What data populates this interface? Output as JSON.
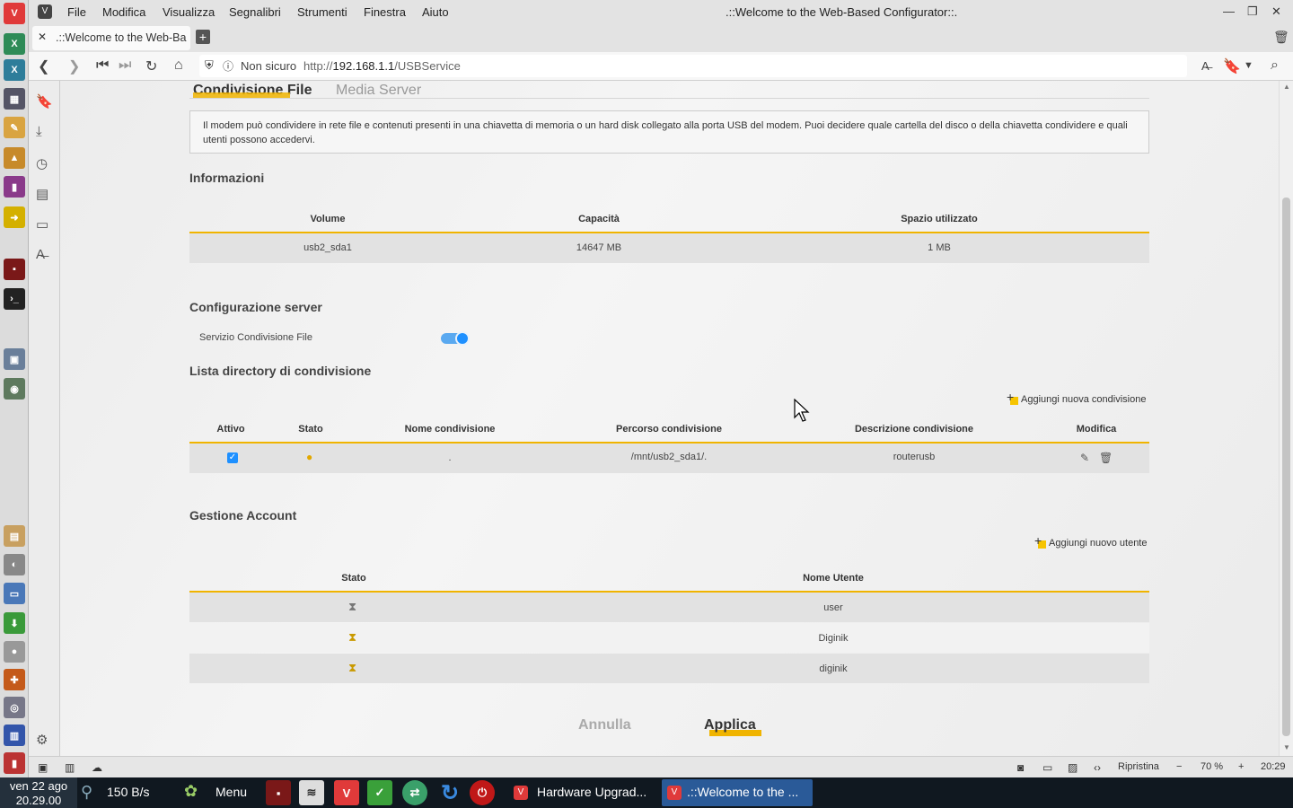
{
  "browser": {
    "menu": [
      "File",
      "Modifica",
      "Visualizza",
      "Segnalibri",
      "Strumenti",
      "Finestra",
      "Aiuto"
    ],
    "window_title": ".::Welcome to the Web-Based Configurator::.",
    "tab_title": ".::Welcome to the Web-Ba",
    "security_label": "Non sicuro",
    "url_prefix": "http://",
    "url_host": "192.168.1.1",
    "url_path": "/USBService"
  },
  "page": {
    "tabs": [
      "Condivisione File",
      "Media Server"
    ],
    "description": "Il modem può condividere in rete file e contenuti presenti in una chiavetta di memoria o un hard disk collegato alla porta USB del modem. Puoi decidere quale cartella del disco o della chiavetta condividere e quali utenti possono accedervi.",
    "info": {
      "title": "Informazioni",
      "headers": [
        "Volume",
        "Capacità",
        "Spazio utilizzato"
      ],
      "row": [
        "usb2_sda1",
        "14647 MB",
        "1 MB"
      ]
    },
    "server": {
      "title": "Configurazione server",
      "service_label": "Servizio Condivisione File",
      "service_enabled": true
    },
    "shares": {
      "title": "Lista directory di condivisione",
      "add_label": "Aggiungi nuova condivisione",
      "headers": [
        "Attivo",
        "Stato",
        "Nome condivisione",
        "Percorso condivisione",
        "Descrizione condivisione",
        "Modifica"
      ],
      "row": {
        "active": true,
        "name": ".",
        "path": "/mnt/usb2_sda1/.",
        "description": "routerusb"
      }
    },
    "accounts": {
      "title": "Gestione Account",
      "add_label": "Aggiungi nuovo utente",
      "headers": [
        "Stato",
        "Nome Utente"
      ],
      "users": [
        "user",
        "Diginik",
        "diginik"
      ]
    },
    "buttons": {
      "cancel": "Annulla",
      "apply": "Applica"
    }
  },
  "statusbar": {
    "reset": "Ripristina",
    "zoom": "70 %",
    "time": "20:29"
  },
  "taskbar": {
    "date": "ven 22 ago",
    "clock": "20.29.00",
    "net": "150 B/s",
    "menu": "Menu",
    "windows": [
      "Hardware Upgrad...",
      ".::Welcome to the ..."
    ]
  },
  "colors": {
    "accent": "#f0b400",
    "toggle": "#1e90ff",
    "vivaldi": "#ef3939",
    "taskbar": "#101820"
  }
}
